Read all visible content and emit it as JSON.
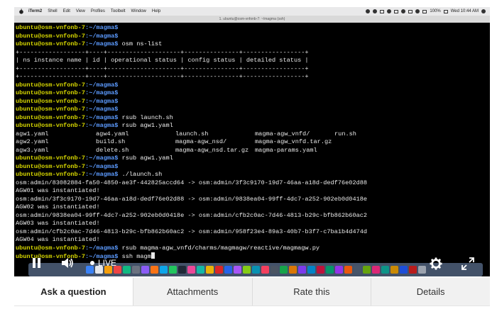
{
  "menubar": {
    "items": [
      "iTerm2",
      "Shell",
      "Edit",
      "View",
      "Profiles",
      "Toolbelt",
      "Window",
      "Help"
    ],
    "battery": "100%",
    "clock": "Wed 10:44 AM"
  },
  "window_title": "1. ubuntu@osm-vnfonb-7: ~/magma (ssh)",
  "terminal": {
    "prompt": "ubuntu@osm-vnfonb-7",
    "path": ":~/magma$",
    "lines": [
      {
        "type": "prompt",
        "cmd": ""
      },
      {
        "type": "prompt",
        "cmd": ""
      },
      {
        "type": "prompt",
        "cmd": " osm ns-list"
      },
      {
        "type": "text",
        "text": "+------------------+----+--------------------+---------------+-----------------+"
      },
      {
        "type": "text",
        "text": "| ns instance name | id | operational status | config status | detailed status |"
      },
      {
        "type": "text",
        "text": "+------------------+----+--------------------+---------------+-----------------+"
      },
      {
        "type": "text",
        "text": "+------------------+----+--------------------+---------------+-----------------+"
      },
      {
        "type": "prompt",
        "cmd": ""
      },
      {
        "type": "prompt",
        "cmd": ""
      },
      {
        "type": "prompt",
        "cmd": ""
      },
      {
        "type": "prompt",
        "cmd": ""
      },
      {
        "type": "prompt",
        "cmd": " rsub launch.sh"
      },
      {
        "type": "prompt",
        "cmd": " rsub agw1.yaml"
      }
    ],
    "ls_rows": [
      [
        "agw1.yaml",
        "agw4.yaml",
        "launch.sh",
        "magma-agw_vnfd/",
        "run.sh"
      ],
      [
        "agw2.yaml",
        "build.sh",
        "magma-agw_nsd/",
        "magma-agw_vnfd.tar.gz",
        ""
      ],
      [
        "agw3.yaml",
        "delete.sh",
        "magma-agw_nsd.tar.gz",
        "magma-params.yaml",
        ""
      ]
    ],
    "lines2": [
      {
        "type": "prompt",
        "cmd": " rsub agw1.yaml"
      },
      {
        "type": "prompt",
        "cmd": ""
      },
      {
        "type": "prompt",
        "cmd": " ./launch.sh"
      },
      {
        "type": "text",
        "text": "osm:admin/83082884-fa50-4850-ae3f-442825accd64 -> osm:admin/3f3c9170-19d7-46aa-a18d-dedf76e02d88"
      },
      {
        "type": "text",
        "text": "AGW01 was instantiated!"
      },
      {
        "type": "text",
        "text": "osm:admin/3f3c9170-19d7-46aa-a18d-dedf76e02d88 -> osm:admin/9838ea04-99ff-4dc7-a252-902eb0d0418e"
      },
      {
        "type": "text",
        "text": "AGW02 was instantiated!"
      },
      {
        "type": "text",
        "text": "osm:admin/9838ea04-99ff-4dc7-a252-902eb0d0418e -> osm:admin/cfb2c0ac-7d46-4813-b29c-bfb862b60ac2"
      },
      {
        "type": "text",
        "text": "AGW03 was instantiated!"
      },
      {
        "type": "text",
        "text": "osm:admin/cfb2c0ac-7d46-4813-b29c-bfb862b60ac2 -> osm:admin/958f23e4-89a3-40b7-b3f7-c7ba1b4d474d"
      },
      {
        "type": "text",
        "text": "AGW04 was instantiated!"
      },
      {
        "type": "prompt",
        "cmd": " rsub magma-agw_vnfd/charms/magmagw/reactive/magmagw.py"
      },
      {
        "type": "prompt",
        "cmd": " ssh magm",
        "cursor": true
      }
    ]
  },
  "player": {
    "live_label": "LIVE"
  },
  "tabs": [
    {
      "label": "Ask a question",
      "active": true
    },
    {
      "label": "Attachments",
      "active": false
    },
    {
      "label": "Rate this",
      "active": false
    },
    {
      "label": "Details",
      "active": false
    }
  ],
  "colors": {
    "prompt": "#d7d700",
    "path": "#5c9bff",
    "terminal_bg": "#000000",
    "tab_bg": "#f1f1f1",
    "tab_active_bg": "#ffffff"
  }
}
